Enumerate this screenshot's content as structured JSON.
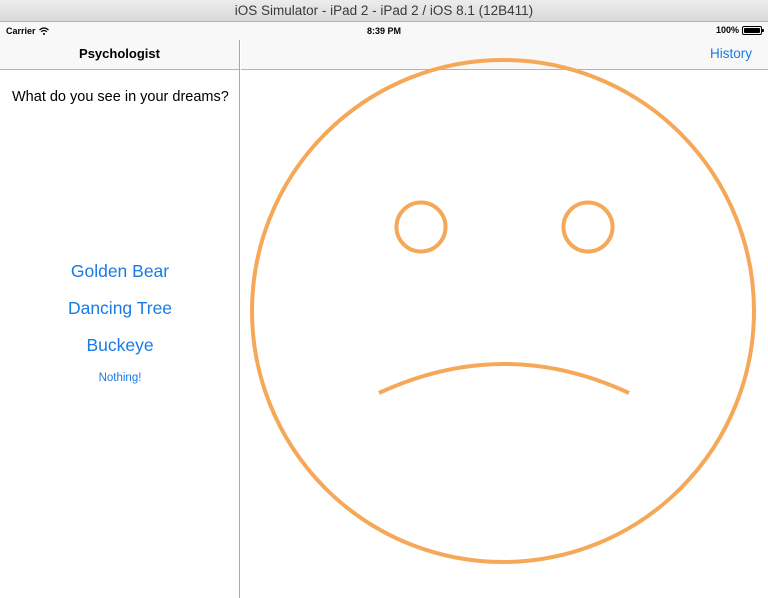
{
  "window": {
    "title": "iOS Simulator - iPad 2 - iPad 2 / iOS 8.1 (12B411)"
  },
  "status_bar": {
    "carrier": "Carrier",
    "time": "8:39 PM",
    "battery": "100%"
  },
  "master": {
    "nav_title": "Psychologist",
    "question": "What do you see in your dreams?",
    "choices": [
      "Golden Bear",
      "Dancing Tree",
      "Buckeye"
    ],
    "nothing_label": "Nothing!"
  },
  "detail": {
    "history_label": "History",
    "face": {
      "color": "#f5a858",
      "mood": "sad"
    }
  },
  "colors": {
    "accent": "#1a7ae6",
    "face": "#f5a858"
  }
}
